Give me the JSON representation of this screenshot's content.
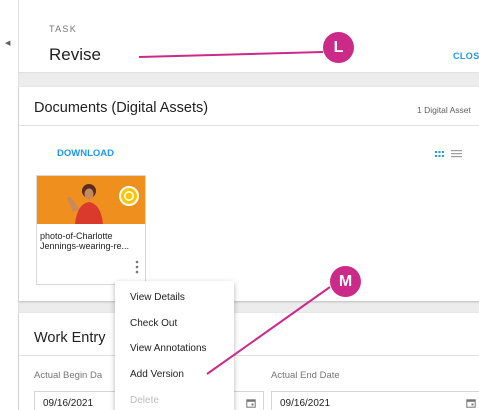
{
  "task_header": {
    "label": "TASK",
    "name": "Revise",
    "close_label": "CLOS"
  },
  "documents": {
    "title": "Documents (Digital Assets)",
    "asset_count": "1 Digital Asset",
    "download_label": "DOWNLOAD",
    "asset": {
      "name": "photo-of-Charlotte Jennings-wearing-re..."
    }
  },
  "context_menu": {
    "items": [
      {
        "label": "View Details"
      },
      {
        "label": "Check Out"
      },
      {
        "label": "View Annotations"
      },
      {
        "label": "Add Version"
      },
      {
        "label": "Delete",
        "disabled": true
      }
    ]
  },
  "work_entry": {
    "title": "Work Entry",
    "begin_label": "Actual Begin Da",
    "begin_value": "09/16/2021",
    "end_label": "Actual End Date",
    "end_value": "09/16/2021"
  },
  "callouts": [
    "L",
    "M"
  ],
  "colors": {
    "accent": "#2196f3",
    "callout": "#cc2a88",
    "thumbnail": "#ef8f1e"
  }
}
